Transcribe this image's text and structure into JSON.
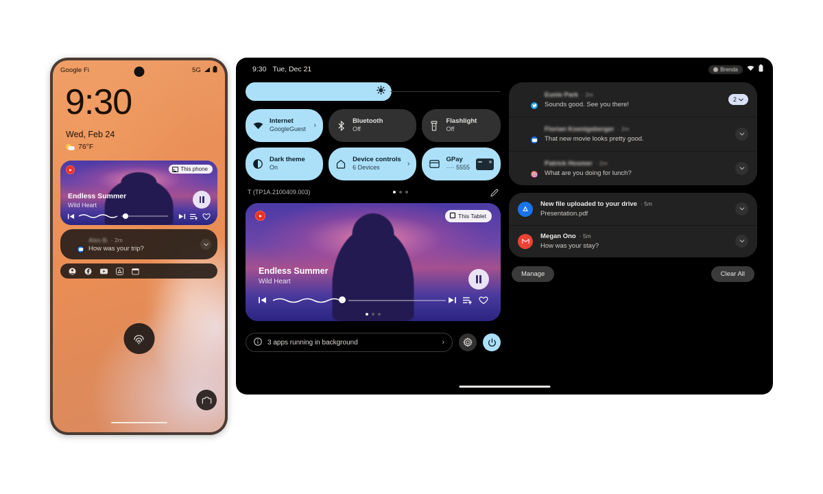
{
  "phone": {
    "status": {
      "carrier": "Google Fi",
      "network": "5G"
    },
    "clock": "9:30",
    "date": "Wed, Feb 24",
    "temperature": "76°F",
    "media": {
      "title": "Endless Summer",
      "artist": "Wild Heart",
      "cast_label": "This phone",
      "app": "youtube-music"
    },
    "notification": {
      "sender": "Alex B.",
      "time": "2m",
      "body": "How was your trip?",
      "app": "messages"
    },
    "shortcuts": [
      "contact-icon",
      "facebook-icon",
      "youtube-icon",
      "drive-icon",
      "calendar-icon"
    ],
    "fingerprint_hint": "fingerprint-sensor",
    "camera_shortcut": "camera-icon"
  },
  "tablet": {
    "status": {
      "time": "9:30",
      "date": "Tue, Dec 21",
      "user": "Brenda"
    },
    "brightness": {
      "percent": 58
    },
    "tiles": [
      {
        "label": "Internet",
        "sub": "GoogleGuest",
        "state": "on",
        "icon": "wifi-icon",
        "arrow": true
      },
      {
        "label": "Bluetooth",
        "sub": "Off",
        "state": "off",
        "icon": "bluetooth-icon",
        "arrow": false
      },
      {
        "label": "Flashlight",
        "sub": "Off",
        "state": "off",
        "icon": "flashlight-icon",
        "arrow": false
      },
      {
        "label": "Dark theme",
        "sub": "On",
        "state": "on",
        "icon": "dark-theme-icon",
        "arrow": false
      },
      {
        "label": "Device controls",
        "sub": "6 Devices",
        "state": "on",
        "icon": "home-icon",
        "arrow": true
      },
      {
        "label": "GPay",
        "sub": "···· 5555",
        "state": "on",
        "icon": "card-icon",
        "arrow": false
      }
    ],
    "build": "T (TP1A.2100409.003)",
    "page_index": 0,
    "page_count": 3,
    "edit_label": "edit-icon",
    "media": {
      "title": "Endless Summer",
      "artist": "Wild Heart",
      "cast_label": "This Tablet",
      "app": "youtube-music"
    },
    "background_apps": {
      "label": "3 apps running in background"
    },
    "notifications": [
      {
        "sender": "Eunie Park",
        "time": "2m",
        "body": "Sounds good. See you there!",
        "app": "twitter",
        "count": "2",
        "blurred": true
      },
      {
        "sender": "Florian Koenigsberger",
        "time": "2m",
        "body": "That new movie looks pretty good.",
        "app": "messages",
        "blurred": true
      },
      {
        "sender": "Patrick Hosmer",
        "time": "2m",
        "body": "What are you doing for lunch?",
        "app": "instagram",
        "blurred": true
      },
      {
        "sender": "New file uploaded to your drive",
        "time": "5m",
        "body": "Presentation.pdf",
        "app": "drive",
        "blurred": false
      },
      {
        "sender": "Megan Ono",
        "time": "5m",
        "body": "How was your stay?",
        "app": "gmail",
        "blurred": false
      }
    ],
    "actions": {
      "manage": "Manage",
      "clear_all": "Clear All"
    }
  },
  "colors": {
    "accent": "#ace0f9",
    "tile_off": "#313131",
    "panel": "#222222",
    "tablet_bg": "#000000",
    "phone_wallpaper": "#e98f57"
  }
}
